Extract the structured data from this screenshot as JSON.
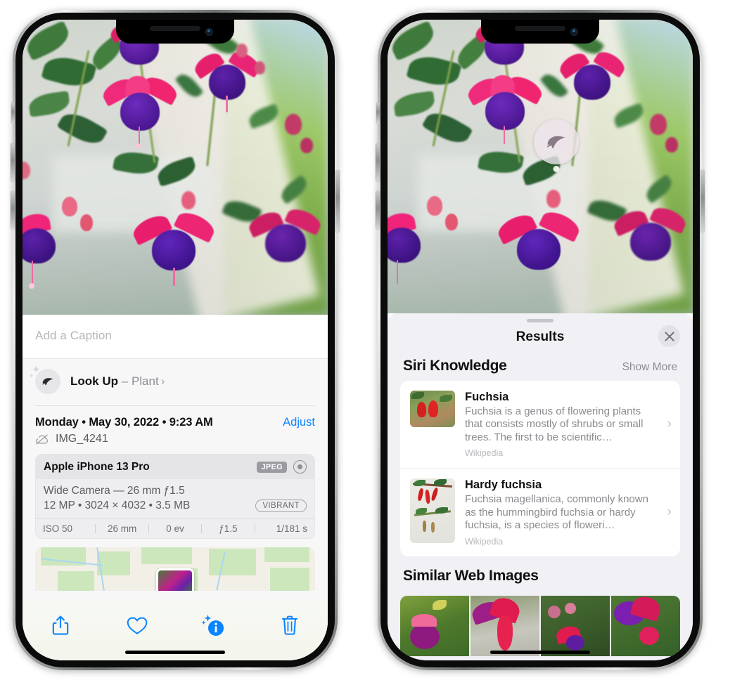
{
  "left_phone": {
    "caption": {
      "placeholder": "Add a Caption",
      "value": ""
    },
    "lookup": {
      "icon": "leaf-icon",
      "label": "Look Up",
      "dash": "–",
      "subject": "Plant",
      "chevron": "›"
    },
    "date_row": {
      "date": "Monday • May 30, 2022 • 9:23 AM",
      "adjust_label": "Adjust"
    },
    "filename": {
      "icon": "cloud-slash-icon",
      "name": "IMG_4241"
    },
    "exif": {
      "device": "Apple iPhone 13 Pro",
      "format_badge": "JPEG",
      "raw_icon": "raw-circle-icon",
      "lens_line": "Wide Camera — 26 mm ƒ1.5",
      "size_line": "12 MP • 3024 × 4032 • 3.5 MB",
      "style_badge": "VIBRANT",
      "stats": [
        "ISO 50",
        "26 mm",
        "0 ev",
        "ƒ1.5",
        "1/181 s"
      ]
    },
    "toolbar": [
      {
        "name": "share-icon",
        "label": "Share"
      },
      {
        "name": "heart-icon",
        "label": "Favorite"
      },
      {
        "name": "info-sparkle-icon",
        "label": "Info"
      },
      {
        "name": "trash-icon",
        "label": "Delete"
      }
    ]
  },
  "right_phone": {
    "badge": {
      "icon": "leaf-icon",
      "label": "Visual Look Up Plant badge"
    },
    "sheet": {
      "grabber": "",
      "title": "Results",
      "close_icon": "close-icon"
    },
    "siri_knowledge": {
      "title": "Siri Knowledge",
      "show_more": "Show More",
      "items": [
        {
          "name": "Fuchsia",
          "description": "Fuchsia is a genus of flowering plants that consists mostly of shrubs or small trees. The first to be scientific…",
          "source": "Wikipedia",
          "chevron": "›"
        },
        {
          "name": "Hardy fuchsia",
          "description": "Fuchsia magellanica, commonly known as the hummingbird fuchsia or hardy fuchsia, is a species of floweri…",
          "source": "Wikipedia",
          "chevron": "›"
        }
      ]
    },
    "similar_web_images": {
      "title": "Similar Web Images",
      "count": 4
    }
  },
  "colors": {
    "accent_blue": "#0A84FF",
    "sheet_bg": "#F0F0F5",
    "card_bg": "#FFFFFF",
    "secondary_text": "#8A8A8F",
    "exif_card_bg": "#EEEEF0"
  }
}
